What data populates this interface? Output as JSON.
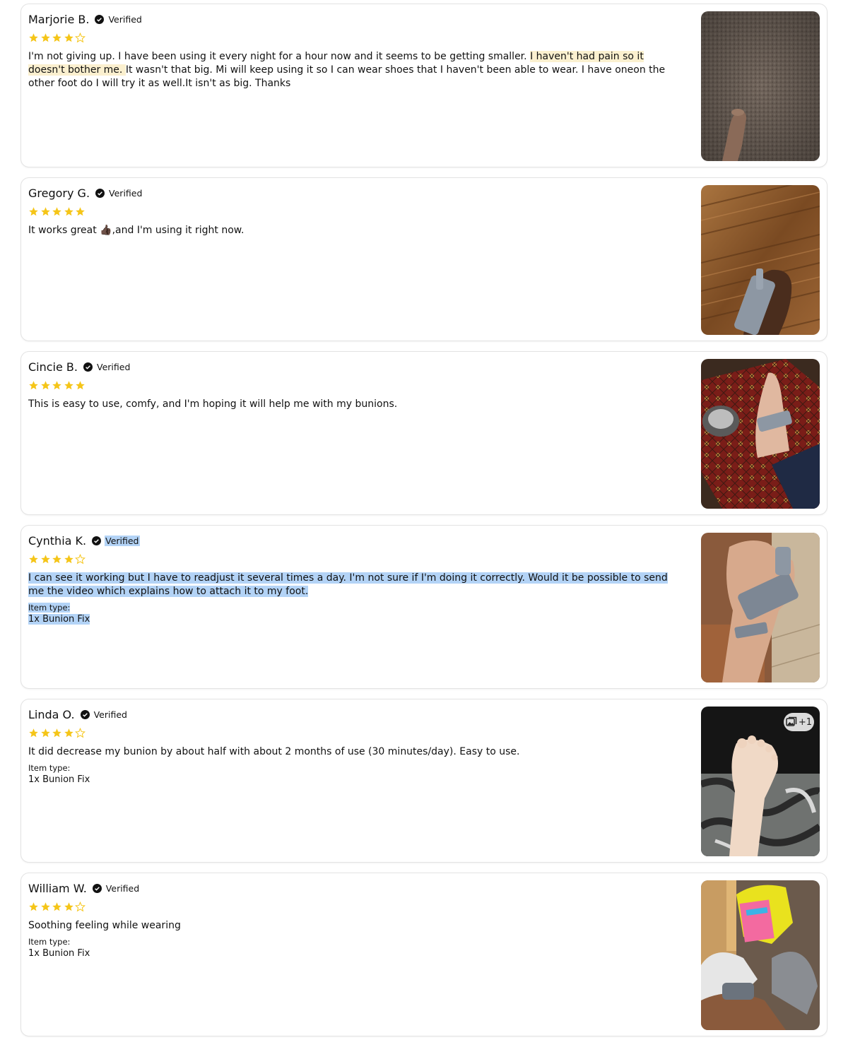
{
  "verified_label": "Verified",
  "item_type_label": "Item type:",
  "star_color": "#f5c518",
  "reviews": [
    {
      "name": "Marjorie B.",
      "rating": 4,
      "text_parts": [
        "I'm not giving up. I have been using it every night for a hour now and it seems to be getting smaller. ",
        " I haven't had pain so it doesn't bother me. ",
        " It wasn't that big. Mi will keep using it so I can wear shoes that I haven't been able to wear.   I have oneon the other foot do I will try it as well.It isn't as big.  Thanks"
      ]
    },
    {
      "name": "Gregory G.",
      "rating": 5,
      "text": "It works great 👍🏿,and I'm using it right now."
    },
    {
      "name": "Cincie B.",
      "rating": 5,
      "text": "This is easy to use, comfy, and I'm hoping it will help me with my bunions."
    },
    {
      "name": "Cynthia K.",
      "rating": 4,
      "text": "I can see it working but I have to readjust it several times a day. I'm not sure if I'm doing it correctly. Would it be possible to send me the video which explains how to attach it to my foot.",
      "item_type": "1x Bunion Fix"
    },
    {
      "name": "Linda O.",
      "rating": 4,
      "text": "It did decrease my bunion by about half with about 2 months of use (30 minutes/day). Easy to use.",
      "item_type": "1x Bunion Fix",
      "more_photos": "+1"
    },
    {
      "name": "William W.",
      "rating": 4,
      "text": "Soothing feeling while wearing",
      "item_type": "1x Bunion Fix"
    }
  ]
}
